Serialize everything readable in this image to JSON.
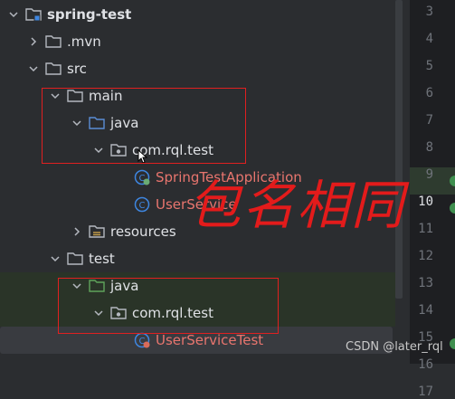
{
  "tree": {
    "root": "spring-test",
    "mvn": ".mvn",
    "src": "src",
    "main": "main",
    "main_java": "java",
    "main_pkg": "com.rql.test",
    "app_class": "SpringTestApplication",
    "service_class": "UserService",
    "resources": "resources",
    "test": "test",
    "test_java": "java",
    "test_pkg": "com.rql.test",
    "test_class": "UserServiceTest"
  },
  "gutter": {
    "lines": [
      "3",
      "4",
      "5",
      "6",
      "7",
      "8",
      "9",
      "10",
      "11",
      "12",
      "13",
      "14",
      "15",
      "16",
      "17"
    ],
    "active_line": "10"
  },
  "annotation": "包名相同",
  "watermark": "CSDN @later_rql",
  "colors": {
    "folder_java_blue": "#5a8dd6",
    "folder_test_green": "#5fa35b",
    "spring_green": "#6aab73",
    "class_blue": "#3e86e0",
    "annotation_red": "#e31b1b"
  }
}
